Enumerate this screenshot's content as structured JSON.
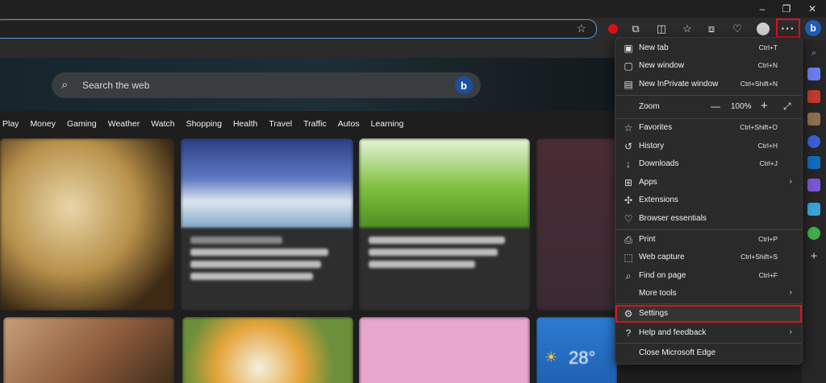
{
  "titlebar": {
    "minimize": "–",
    "restore": "❐",
    "close": "✕"
  },
  "toolbar": {
    "more_label": "···",
    "copilot": "b"
  },
  "search": {
    "placeholder": "Search the web",
    "bing": "b"
  },
  "nav": [
    "Play",
    "Money",
    "Gaming",
    "Weather",
    "Watch",
    "Shopping",
    "Health",
    "Travel",
    "Traffic",
    "Autos",
    "Learning"
  ],
  "weather": {
    "temp": "28°"
  },
  "menu": {
    "new_tab": {
      "label": "New tab",
      "shortcut": "Ctrl+T"
    },
    "new_window": {
      "label": "New window",
      "shortcut": "Ctrl+N"
    },
    "new_inprivate": {
      "label": "New InPrivate window",
      "shortcut": "Ctrl+Shift+N"
    },
    "zoom": {
      "label": "Zoom",
      "minus": "—",
      "value": "100%",
      "plus": "+"
    },
    "favorites": {
      "label": "Favorites",
      "shortcut": "Ctrl+Shift+O"
    },
    "history": {
      "label": "History",
      "shortcut": "Ctrl+H"
    },
    "downloads": {
      "label": "Downloads",
      "shortcut": "Ctrl+J"
    },
    "apps": {
      "label": "Apps"
    },
    "extensions": {
      "label": "Extensions"
    },
    "browser_essentials": {
      "label": "Browser essentials"
    },
    "print": {
      "label": "Print",
      "shortcut": "Ctrl+P"
    },
    "web_capture": {
      "label": "Web capture",
      "shortcut": "Ctrl+Shift+S"
    },
    "find_on_page": {
      "label": "Find on page",
      "shortcut": "Ctrl+F"
    },
    "more_tools": {
      "label": "More tools"
    },
    "settings": {
      "label": "Settings"
    },
    "help": {
      "label": "Help and feedback"
    },
    "close_edge": {
      "label": "Close Microsoft Edge"
    }
  },
  "colors": {
    "highlight": "#d7141e",
    "accent": "#5c9bd6"
  }
}
